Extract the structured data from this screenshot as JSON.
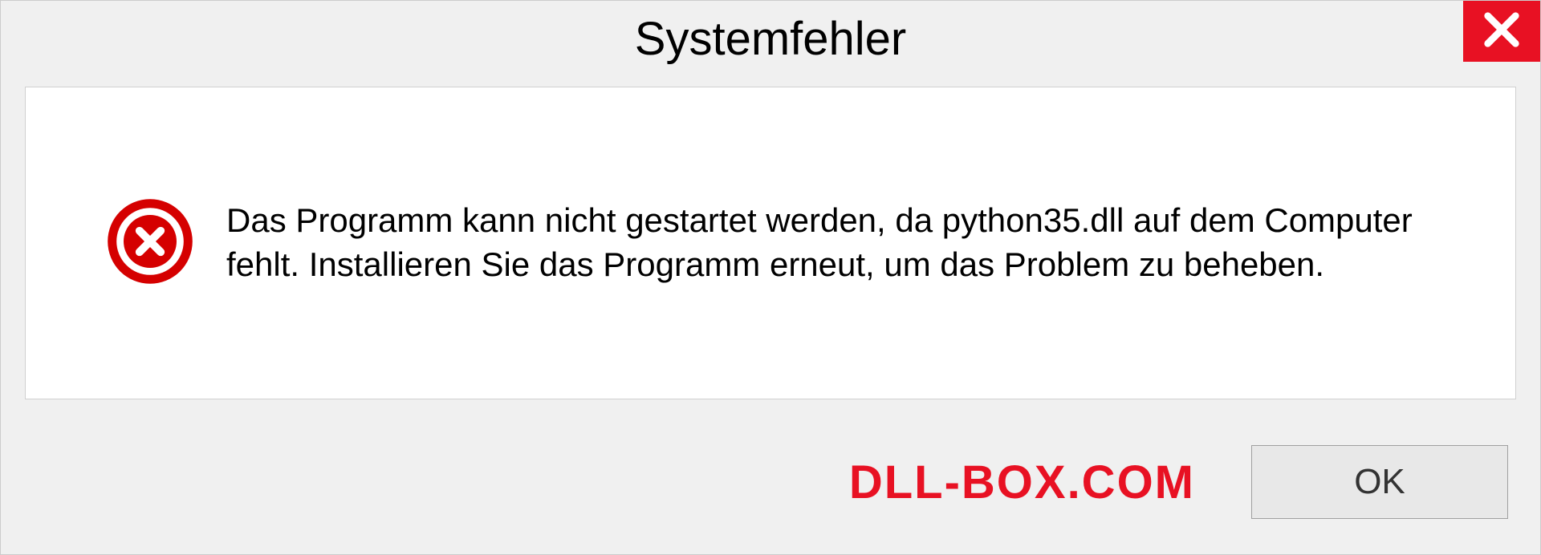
{
  "dialog": {
    "title": "Systemfehler",
    "message": "Das Programm kann nicht gestartet werden, da python35.dll auf dem Computer fehlt. Installieren Sie das Programm erneut, um das Problem zu beheben.",
    "ok_label": "OK"
  },
  "watermark": "DLL-BOX.COM"
}
